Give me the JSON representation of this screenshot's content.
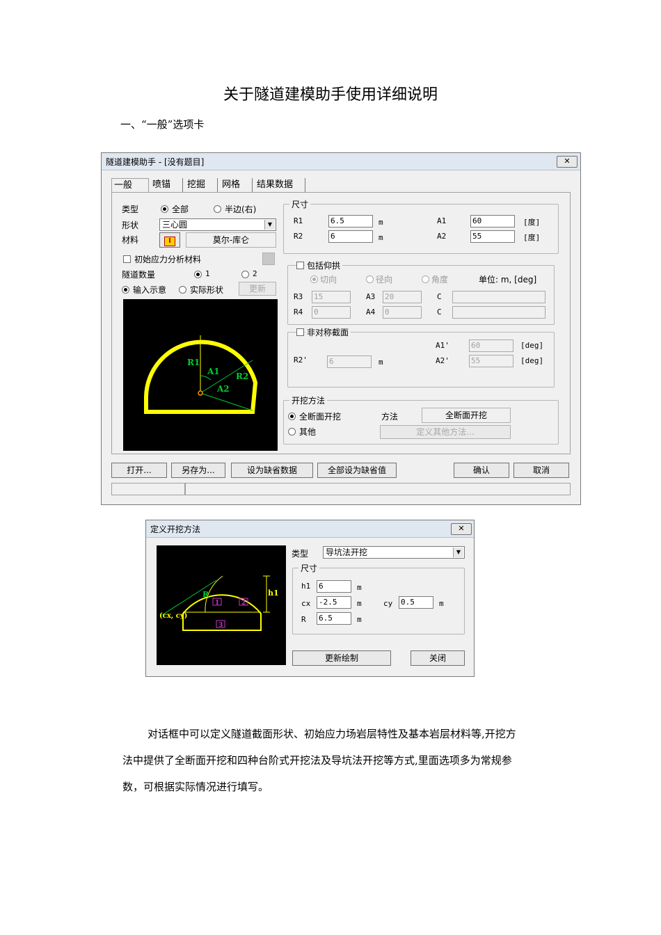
{
  "doc": {
    "title": "关于隧道建模助手使用详细说明",
    "section_heading": "一、“一般”选项卡",
    "paragraph_lines": [
      "对话框中可以定义隧道截面形状、初始应力场岩层特性及基本岩层材料等,开挖方",
      "法中提供了全断面开挖和四种台阶式开挖法及导坑法开挖等方式,里面选项多为常规参",
      "数，可根据实际情况进行填写。"
    ]
  },
  "main_dialog": {
    "title": "隧道建模助手 - [没有题目]",
    "close_glyph": "✕",
    "tabs": [
      "一般",
      "喷锚",
      "挖掘",
      "网格",
      "结果数据"
    ],
    "type_label": "类型",
    "type_options": [
      "全部",
      "半边(右)"
    ],
    "shape_label": "形状",
    "shape_value": "三心圆",
    "material_label": "材料",
    "material_icon_text": "I",
    "material_value": "莫尔-库仑",
    "initial_stress_label": "初始应力分析材料",
    "tunnel_count_label": "隧道数量",
    "tunnel_count_options": [
      "1",
      "2"
    ],
    "input_sketch_label": "输入示意",
    "actual_shape_label": "实际形状",
    "update_label": "更新",
    "preview_labels": {
      "r1": "R1",
      "a1": "A1",
      "r2": "R2",
      "a2": "A2"
    },
    "size_group": {
      "title": "尺寸",
      "r1_label": "R1",
      "r1_value": "6.5",
      "r1_unit": "m",
      "r2_label": "R2",
      "r2_value": "6",
      "r2_unit": "m",
      "a1_label": "A1",
      "a1_value": "60",
      "a1_unit": "[度]",
      "a2_label": "A2",
      "a2_value": "55",
      "a2_unit": "[度]"
    },
    "invert_group": {
      "title": "包括仰拱",
      "options": [
        "切向",
        "径向",
        "角度"
      ],
      "unit_label": "单位: m, [deg]",
      "r3_label": "R3",
      "r3_value": "15",
      "a3_label": "A3",
      "a3_value": "20",
      "c_label": "C",
      "r4_label": "R4",
      "r4_value": "0",
      "a4_label": "A4",
      "a4_value": "0"
    },
    "asym_group": {
      "title": "非对称截面",
      "a1p_label": "A1'",
      "a1p_value": "60",
      "a1p_unit": "[deg]",
      "r2p_label": "R2'",
      "r2p_value": "6",
      "r2p_unit": "m",
      "a2p_label": "A2'",
      "a2p_value": "55",
      "a2p_unit": "[deg]"
    },
    "excavation_group": {
      "title": "开挖方法",
      "full_label": "全断面开挖",
      "other_label": "其他",
      "method_label": "方法",
      "method_value": "全断面开挖",
      "define_other_label": "定义其他方法..."
    },
    "buttons": {
      "open": "打开...",
      "save_as": "另存为...",
      "set_default": "设为缺省数据",
      "all_default": "全部设为缺省值",
      "ok": "确认",
      "cancel": "取消"
    }
  },
  "excav_dialog": {
    "title": "定义开挖方法",
    "close_glyph": "✕",
    "type_label": "类型",
    "type_value": "导坑法开挖",
    "size_title": "尺寸",
    "h1_label": "h1",
    "h1_value": "6",
    "h1_unit": "m",
    "cx_label": "cx",
    "cx_value": "-2.5",
    "cx_unit": "m",
    "cy_label": "cy",
    "cy_value": "0.5",
    "cy_unit": "m",
    "r_label": "R",
    "r_value": "6.5",
    "r_unit": "m",
    "preview_labels": {
      "r": "R",
      "h1": "h1",
      "cxcy": "(cx, cy)",
      "p1": "1",
      "p2": "2",
      "p3": "3"
    },
    "buttons": {
      "redraw": "更新绘制",
      "close": "关闭"
    }
  }
}
